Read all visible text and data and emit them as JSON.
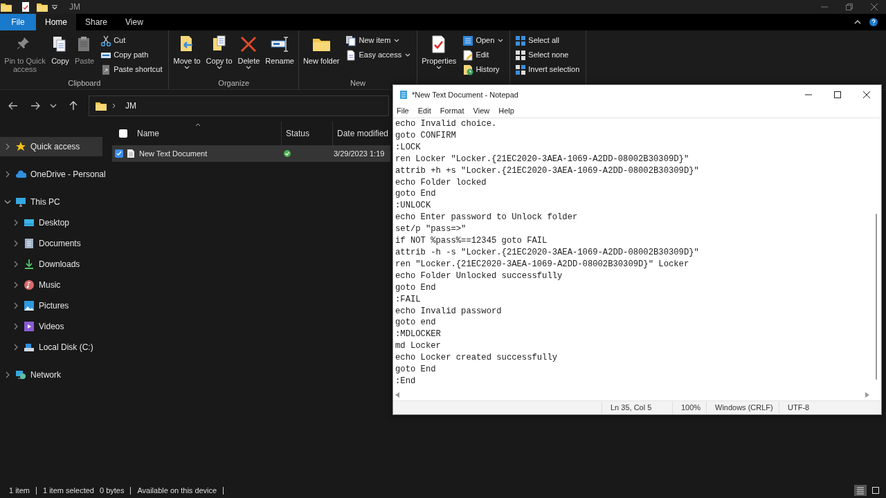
{
  "title_bar": {
    "title": "JM"
  },
  "ribbon": {
    "tabs": [
      {
        "label": "File",
        "kind": "file",
        "selected": false
      },
      {
        "label": "Home",
        "kind": "tab",
        "selected": true
      },
      {
        "label": "Share",
        "kind": "tab",
        "selected": false
      },
      {
        "label": "View",
        "kind": "tab",
        "selected": false
      }
    ],
    "groups": [
      {
        "label": "Clipboard",
        "items": [
          {
            "label": "Pin to Quick access",
            "kind": "large",
            "disabled": true,
            "dropdown": false
          },
          {
            "label": "Copy",
            "kind": "large",
            "disabled": false,
            "dropdown": false
          },
          {
            "label": "Paste",
            "kind": "large",
            "disabled": true,
            "dropdown": false
          },
          {
            "label": "Cut",
            "kind": "small",
            "disabled": false,
            "dropdown": false
          },
          {
            "label": "Copy path",
            "kind": "small",
            "disabled": false,
            "dropdown": false
          },
          {
            "label": "Paste shortcut",
            "kind": "small",
            "disabled": false,
            "dropdown": false
          }
        ]
      },
      {
        "label": "Organize",
        "items": [
          {
            "label": "Move to",
            "kind": "large",
            "disabled": false,
            "dropdown": true
          },
          {
            "label": "Copy to",
            "kind": "large",
            "disabled": false,
            "dropdown": true
          },
          {
            "label": "Delete",
            "kind": "large",
            "disabled": false,
            "dropdown": true
          },
          {
            "label": "Rename",
            "kind": "large",
            "disabled": false,
            "dropdown": false
          }
        ]
      },
      {
        "label": "New",
        "items": [
          {
            "label": "New folder",
            "kind": "large",
            "disabled": false,
            "dropdown": false
          },
          {
            "label": "New item",
            "kind": "small",
            "disabled": false,
            "dropdown": true
          },
          {
            "label": "Easy access",
            "kind": "small",
            "disabled": false,
            "dropdown": true
          }
        ]
      },
      {
        "items": [
          {
            "label": "Properties",
            "kind": "large",
            "disabled": false,
            "dropdown": true
          },
          {
            "label": "Open",
            "kind": "small",
            "disabled": false,
            "dropdown": true
          },
          {
            "label": "Edit",
            "kind": "small",
            "disabled": false,
            "dropdown": false
          },
          {
            "label": "History",
            "kind": "small",
            "disabled": false,
            "dropdown": false
          }
        ]
      },
      {
        "items": [
          {
            "label": "Select all",
            "kind": "small",
            "disabled": false,
            "dropdown": false
          },
          {
            "label": "Select none",
            "kind": "small",
            "disabled": false,
            "dropdown": false
          },
          {
            "label": "Invert selection",
            "kind": "small",
            "disabled": false,
            "dropdown": false
          }
        ]
      }
    ]
  },
  "address_bar": {
    "path": "JM"
  },
  "nav_pane": {
    "items": [
      {
        "label": "Quick access",
        "selected": true,
        "expanded": false
      },
      {
        "label": "OneDrive - Personal",
        "selected": false,
        "expanded": false
      },
      {
        "label": "This PC",
        "selected": false,
        "expanded": true,
        "children": [
          {
            "label": "Desktop",
            "selected": false,
            "expanded": false
          },
          {
            "label": "Documents",
            "selected": false,
            "expanded": false
          },
          {
            "label": "Downloads",
            "selected": false,
            "expanded": false
          },
          {
            "label": "Music",
            "selected": false,
            "expanded": false
          },
          {
            "label": "Pictures",
            "selected": false,
            "expanded": false
          },
          {
            "label": "Videos",
            "selected": false,
            "expanded": false
          },
          {
            "label": "Local Disk (C:)",
            "selected": false,
            "expanded": false
          }
        ]
      },
      {
        "label": "Network",
        "selected": false,
        "expanded": false
      }
    ]
  },
  "file_list": {
    "select_all_checked": false,
    "columns": [
      "Name",
      "Status",
      "Date modified"
    ],
    "rows": [
      {
        "name": "New Text Document",
        "date_modified": "3/29/2023 1:19",
        "selected": true,
        "checked": true
      }
    ]
  },
  "status_bar": {
    "item_count": "1 item",
    "selection": "1 item selected",
    "size": "0 bytes",
    "availability": "Available on this device",
    "views": [
      {
        "kind": "details",
        "selected": true
      },
      {
        "kind": "large_icons",
        "selected": false
      }
    ]
  },
  "notepad": {
    "title": "*New Text Document - Notepad",
    "menu": [
      "File",
      "Edit",
      "Format",
      "View",
      "Help"
    ],
    "lines": [
      "echo Invalid choice.",
      "goto CONFIRM",
      ":LOCK",
      "ren Locker \"Locker.{21EC2020-3AEA-1069-A2DD-08002B30309D}\"",
      "attrib +h +s \"Locker.{21EC2020-3AEA-1069-A2DD-08002B30309D}\"",
      "echo Folder locked",
      "goto End",
      ":UNLOCK",
      "echo Enter password to Unlock folder",
      "set/p \"pass=>\"",
      "if NOT %pass%==12345 goto FAIL",
      "attrib -h -s \"Locker.{21EC2020-3AEA-1069-A2DD-08002B30309D}\"",
      "ren \"Locker.{21EC2020-3AEA-1069-A2DD-08002B30309D}\" Locker",
      "echo Folder Unlocked successfully",
      "goto End",
      ":FAIL",
      "echo Invalid password",
      "goto end",
      ":MDLOCKER",
      "md Locker",
      "echo Locker created successfully",
      "goto End",
      ":End"
    ],
    "status": {
      "position": "Ln 35, Col 5",
      "zoom": "100%",
      "line_endings": "Windows (CRLF)",
      "encoding": "UTF-8"
    }
  }
}
